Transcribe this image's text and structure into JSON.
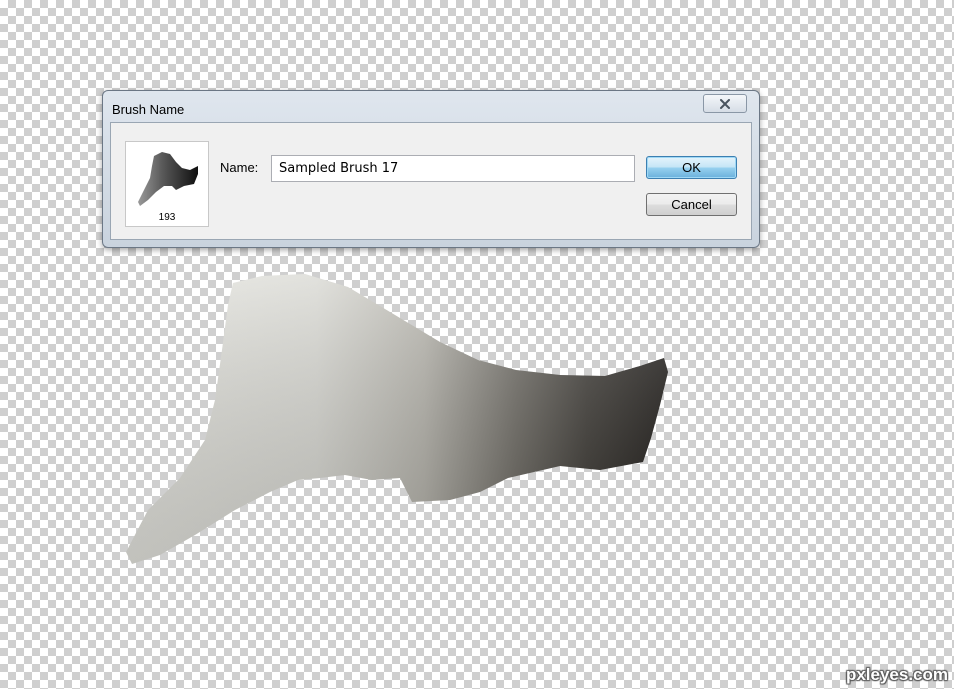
{
  "dialog": {
    "title": "Brush Name",
    "brush_size": "193",
    "name_label": "Name:",
    "name_value": "Sampled Brush 17",
    "ok_label": "OK",
    "cancel_label": "Cancel"
  },
  "watermark": "pxleyes.com",
  "icons": {
    "close": "close-icon",
    "brush_preview": "brush-preview-icon"
  }
}
